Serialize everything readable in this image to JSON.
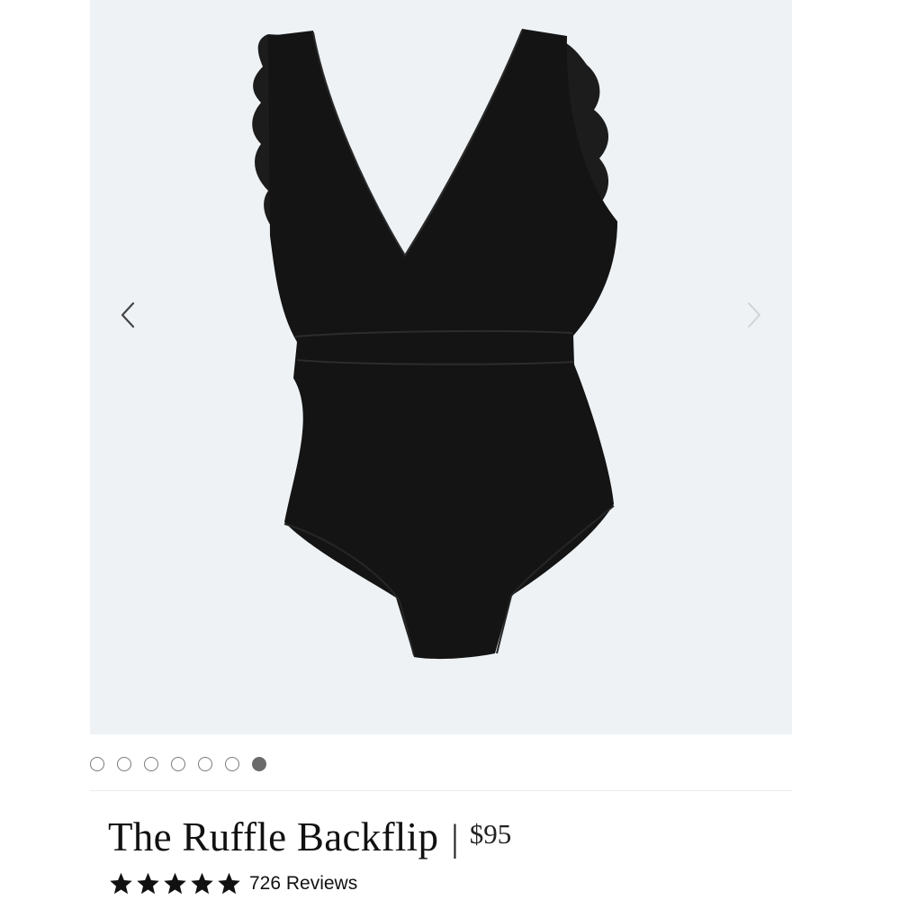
{
  "product": {
    "title": "The Ruffle Backflip",
    "separator": "|",
    "price": "$95",
    "rating": 5,
    "rating_max": 5,
    "reviews_label": "726 Reviews"
  },
  "gallery": {
    "slide_count": 7,
    "active_slide": 7,
    "prev_icon": "chevron-left-icon",
    "next_icon": "chevron-right-icon",
    "background_color": "#eef2f5",
    "garment_color": "#141414"
  },
  "colors": {
    "accent": "#4a5ee8",
    "dot_active": "#6b6b6b",
    "dot_border": "#7a7a7a"
  }
}
